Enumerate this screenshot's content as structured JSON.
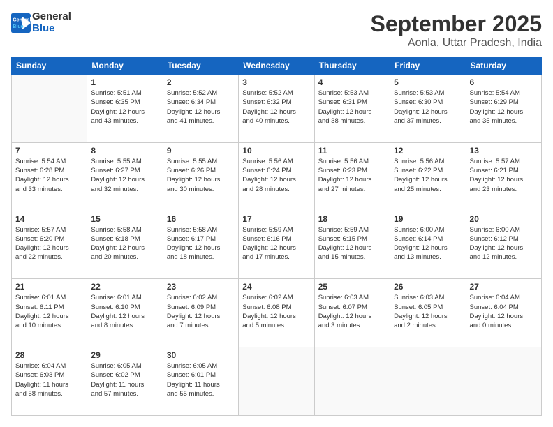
{
  "logo": {
    "line1": "General",
    "line2": "Blue"
  },
  "header": {
    "month": "September 2025",
    "location": "Aonla, Uttar Pradesh, India"
  },
  "weekdays": [
    "Sunday",
    "Monday",
    "Tuesday",
    "Wednesday",
    "Thursday",
    "Friday",
    "Saturday"
  ],
  "weeks": [
    [
      {
        "day": "",
        "info": ""
      },
      {
        "day": "1",
        "info": "Sunrise: 5:51 AM\nSunset: 6:35 PM\nDaylight: 12 hours\nand 43 minutes."
      },
      {
        "day": "2",
        "info": "Sunrise: 5:52 AM\nSunset: 6:34 PM\nDaylight: 12 hours\nand 41 minutes."
      },
      {
        "day": "3",
        "info": "Sunrise: 5:52 AM\nSunset: 6:32 PM\nDaylight: 12 hours\nand 40 minutes."
      },
      {
        "day": "4",
        "info": "Sunrise: 5:53 AM\nSunset: 6:31 PM\nDaylight: 12 hours\nand 38 minutes."
      },
      {
        "day": "5",
        "info": "Sunrise: 5:53 AM\nSunset: 6:30 PM\nDaylight: 12 hours\nand 37 minutes."
      },
      {
        "day": "6",
        "info": "Sunrise: 5:54 AM\nSunset: 6:29 PM\nDaylight: 12 hours\nand 35 minutes."
      }
    ],
    [
      {
        "day": "7",
        "info": "Sunrise: 5:54 AM\nSunset: 6:28 PM\nDaylight: 12 hours\nand 33 minutes."
      },
      {
        "day": "8",
        "info": "Sunrise: 5:55 AM\nSunset: 6:27 PM\nDaylight: 12 hours\nand 32 minutes."
      },
      {
        "day": "9",
        "info": "Sunrise: 5:55 AM\nSunset: 6:26 PM\nDaylight: 12 hours\nand 30 minutes."
      },
      {
        "day": "10",
        "info": "Sunrise: 5:56 AM\nSunset: 6:24 PM\nDaylight: 12 hours\nand 28 minutes."
      },
      {
        "day": "11",
        "info": "Sunrise: 5:56 AM\nSunset: 6:23 PM\nDaylight: 12 hours\nand 27 minutes."
      },
      {
        "day": "12",
        "info": "Sunrise: 5:56 AM\nSunset: 6:22 PM\nDaylight: 12 hours\nand 25 minutes."
      },
      {
        "day": "13",
        "info": "Sunrise: 5:57 AM\nSunset: 6:21 PM\nDaylight: 12 hours\nand 23 minutes."
      }
    ],
    [
      {
        "day": "14",
        "info": "Sunrise: 5:57 AM\nSunset: 6:20 PM\nDaylight: 12 hours\nand 22 minutes."
      },
      {
        "day": "15",
        "info": "Sunrise: 5:58 AM\nSunset: 6:18 PM\nDaylight: 12 hours\nand 20 minutes."
      },
      {
        "day": "16",
        "info": "Sunrise: 5:58 AM\nSunset: 6:17 PM\nDaylight: 12 hours\nand 18 minutes."
      },
      {
        "day": "17",
        "info": "Sunrise: 5:59 AM\nSunset: 6:16 PM\nDaylight: 12 hours\nand 17 minutes."
      },
      {
        "day": "18",
        "info": "Sunrise: 5:59 AM\nSunset: 6:15 PM\nDaylight: 12 hours\nand 15 minutes."
      },
      {
        "day": "19",
        "info": "Sunrise: 6:00 AM\nSunset: 6:14 PM\nDaylight: 12 hours\nand 13 minutes."
      },
      {
        "day": "20",
        "info": "Sunrise: 6:00 AM\nSunset: 6:12 PM\nDaylight: 12 hours\nand 12 minutes."
      }
    ],
    [
      {
        "day": "21",
        "info": "Sunrise: 6:01 AM\nSunset: 6:11 PM\nDaylight: 12 hours\nand 10 minutes."
      },
      {
        "day": "22",
        "info": "Sunrise: 6:01 AM\nSunset: 6:10 PM\nDaylight: 12 hours\nand 8 minutes."
      },
      {
        "day": "23",
        "info": "Sunrise: 6:02 AM\nSunset: 6:09 PM\nDaylight: 12 hours\nand 7 minutes."
      },
      {
        "day": "24",
        "info": "Sunrise: 6:02 AM\nSunset: 6:08 PM\nDaylight: 12 hours\nand 5 minutes."
      },
      {
        "day": "25",
        "info": "Sunrise: 6:03 AM\nSunset: 6:07 PM\nDaylight: 12 hours\nand 3 minutes."
      },
      {
        "day": "26",
        "info": "Sunrise: 6:03 AM\nSunset: 6:05 PM\nDaylight: 12 hours\nand 2 minutes."
      },
      {
        "day": "27",
        "info": "Sunrise: 6:04 AM\nSunset: 6:04 PM\nDaylight: 12 hours\nand 0 minutes."
      }
    ],
    [
      {
        "day": "28",
        "info": "Sunrise: 6:04 AM\nSunset: 6:03 PM\nDaylight: 11 hours\nand 58 minutes."
      },
      {
        "day": "29",
        "info": "Sunrise: 6:05 AM\nSunset: 6:02 PM\nDaylight: 11 hours\nand 57 minutes."
      },
      {
        "day": "30",
        "info": "Sunrise: 6:05 AM\nSunset: 6:01 PM\nDaylight: 11 hours\nand 55 minutes."
      },
      {
        "day": "",
        "info": ""
      },
      {
        "day": "",
        "info": ""
      },
      {
        "day": "",
        "info": ""
      },
      {
        "day": "",
        "info": ""
      }
    ]
  ]
}
